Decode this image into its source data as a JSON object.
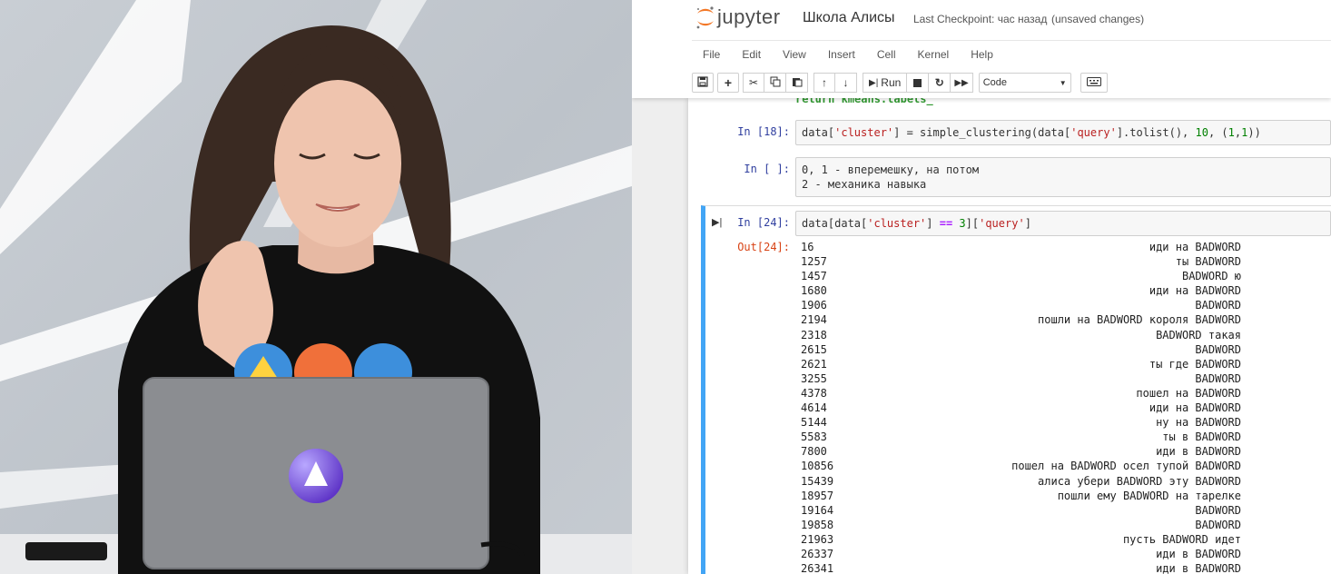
{
  "notebook": {
    "logo_text": "jupyter",
    "title": "Школа Алисы",
    "checkpoint": "Last Checkpoint: час назад",
    "unsaved": "(unsaved changes)"
  },
  "menu": [
    "File",
    "Edit",
    "View",
    "Insert",
    "Cell",
    "Kernel",
    "Help"
  ],
  "toolbar": {
    "run_label": "Run",
    "cell_type": "Code"
  },
  "cells": {
    "partial_top": "return kmeans.labels_",
    "c18": {
      "prompt": "In [18]:",
      "code_parts": [
        "data[",
        "'cluster'",
        "] = simple_clustering(data[",
        "'query'",
        "].tolist(), ",
        "10",
        ", (",
        "1",
        ",",
        "1",
        "))"
      ]
    },
    "c_blank": {
      "prompt": "In [ ]:",
      "line1": "0, 1 - вперемешку, на потом",
      "line2": "2 - механика навыка"
    },
    "c24": {
      "prompt": "In [24]:",
      "code_parts": [
        "data[data[",
        "'cluster'",
        "] ",
        "==",
        " ",
        "3",
        "][",
        "'query'",
        "]"
      ],
      "out_prompt": "Out[24]:",
      "output": [
        {
          "idx": "16",
          "text": "иди на BADWORD"
        },
        {
          "idx": "1257",
          "text": "ты BADWORD"
        },
        {
          "idx": "1457",
          "text": "BADWORD ю"
        },
        {
          "idx": "1680",
          "text": "иди на BADWORD"
        },
        {
          "idx": "1906",
          "text": "BADWORD"
        },
        {
          "idx": "2194",
          "text": "пошли на BADWORD короля BADWORD"
        },
        {
          "idx": "2318",
          "text": "BADWORD такая"
        },
        {
          "idx": "2615",
          "text": "BADWORD"
        },
        {
          "idx": "2621",
          "text": "ты где BADWORD"
        },
        {
          "idx": "3255",
          "text": "BADWORD"
        },
        {
          "idx": "4378",
          "text": "пошел на BADWORD"
        },
        {
          "idx": "4614",
          "text": "иди на BADWORD"
        },
        {
          "idx": "5144",
          "text": "ну на BADWORD"
        },
        {
          "idx": "5583",
          "text": "ты в BADWORD"
        },
        {
          "idx": "7800",
          "text": "иди в BADWORD"
        },
        {
          "idx": "10856",
          "text": "пошел на BADWORD осел тупой BADWORD"
        },
        {
          "idx": "15439",
          "text": "алиса убери BADWORD эту BADWORD"
        },
        {
          "idx": "18957",
          "text": "пошли ему BADWORD на тарелке"
        },
        {
          "idx": "19164",
          "text": "BADWORD"
        },
        {
          "idx": "19858",
          "text": "BADWORD"
        },
        {
          "idx": "21963",
          "text": "пусть BADWORD идет"
        },
        {
          "idx": "26337",
          "text": "иди в BADWORD"
        },
        {
          "idx": "26341",
          "text": "иди в BADWORD"
        }
      ]
    }
  },
  "colors": {
    "selected_cell_bar": "#42a5f5",
    "in_prompt": "#303f9f",
    "out_prompt": "#d84315",
    "logo_orange": "#f37726"
  }
}
